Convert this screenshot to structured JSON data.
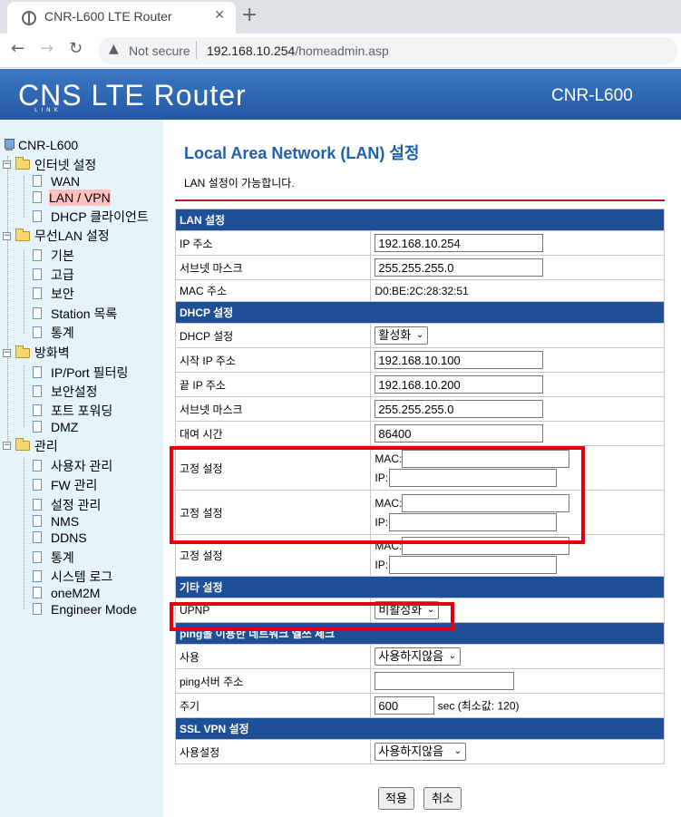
{
  "browser": {
    "tab_title": "CNR-L600 LTE Router",
    "tab_close": "✕",
    "new_tab": "+",
    "security_label": "Not secure",
    "url_host": "192.168.10.254",
    "url_path": "/homeadmin.asp"
  },
  "header": {
    "logo_text": "CNS LTE Router",
    "logo_sub": "LINK",
    "model": "CNR-L600"
  },
  "sidebar": {
    "root": "CNR-L600",
    "items": [
      {
        "label": "인터넷 설정"
      },
      {
        "label": "WAN"
      },
      {
        "label": "LAN / VPN"
      },
      {
        "label": "DHCP 클라이언트"
      },
      {
        "label": "무선LAN 설정"
      },
      {
        "label": "기본"
      },
      {
        "label": "고급"
      },
      {
        "label": "보안"
      },
      {
        "label": "Station 목록"
      },
      {
        "label": "통계"
      },
      {
        "label": "방화벽"
      },
      {
        "label": "IP/Port 필터링"
      },
      {
        "label": "보안설정"
      },
      {
        "label": "포트 포워딩"
      },
      {
        "label": "DMZ"
      },
      {
        "label": "관리"
      },
      {
        "label": "사용자 관리"
      },
      {
        "label": "FW 관리"
      },
      {
        "label": "설정 관리"
      },
      {
        "label": "NMS"
      },
      {
        "label": "DDNS"
      },
      {
        "label": "통계"
      },
      {
        "label": "시스템 로그"
      },
      {
        "label": "oneM2M"
      },
      {
        "label": "Engineer Mode"
      }
    ]
  },
  "main": {
    "title": "Local Area Network (LAN) 설정",
    "description": "LAN 설정이 가능합니다.",
    "lan_section": "LAN 설정",
    "ip_label": "IP 주소",
    "ip_value": "192.168.10.254",
    "subnet_label": "서브넷 마스크",
    "subnet_value": "255.255.255.0",
    "mac_label": "MAC 주소",
    "mac_value": "D0:BE:2C:28:32:51",
    "dhcp_section": "DHCP 설정",
    "dhcp_label": "DHCP 설정",
    "dhcp_value": "활성화",
    "start_ip_label": "시작 IP 주소",
    "start_ip_value": "192.168.10.100",
    "end_ip_label": "끝 IP 주소",
    "end_ip_value": "192.168.10.200",
    "dhcp_subnet_label": "서브넷 마스크",
    "dhcp_subnet_value": "255.255.255.0",
    "lease_label": "대여 시간",
    "lease_value": "86400",
    "static_label": "고정 설정",
    "mac_prefix": "MAC:",
    "ip_prefix": "IP:",
    "etc_section": "기타 설정",
    "upnp_label": "UPNP",
    "upnp_value": "비활성화",
    "ping_section": "ping을 이용한 네트워크 헬쓰 체크",
    "use_label": "사용",
    "use_value": "사용하지않음",
    "ping_server_label": "ping서버 주소",
    "ping_server_value": "",
    "period_label": "주기",
    "period_value": "600",
    "period_hint": "sec (최소값: 120)",
    "ssl_section": "SSL VPN 설정",
    "ssl_label": "사용설정",
    "ssl_value": "사용하지않음",
    "apply_button": "적용",
    "cancel_button": "취소"
  },
  "colors": {
    "banner": "#2f6ab8",
    "section_header": "#1f4f96",
    "highlight_box": "#e0000e",
    "title": "#2060b0"
  }
}
